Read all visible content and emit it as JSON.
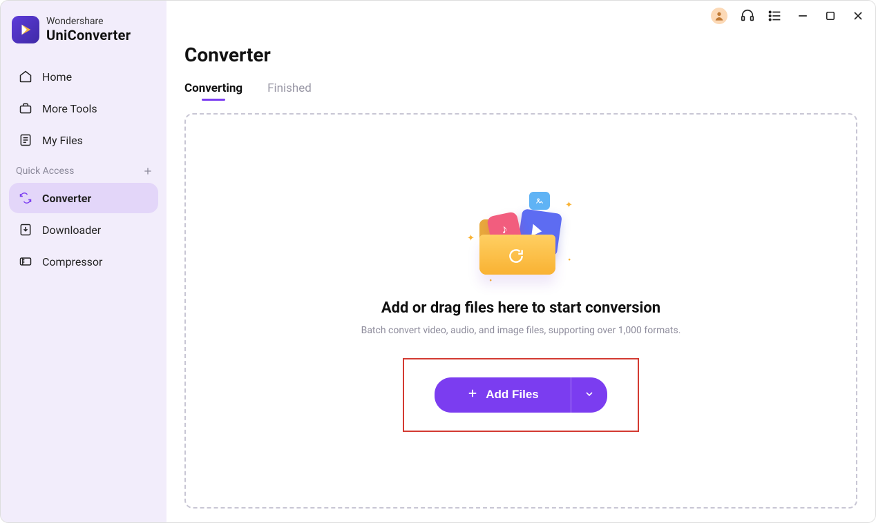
{
  "brand": {
    "top": "Wondershare",
    "bottom": "UniConverter"
  },
  "sidebar": {
    "items": [
      {
        "label": "Home"
      },
      {
        "label": "More Tools"
      },
      {
        "label": "My Files"
      }
    ],
    "quick_label": "Quick Access",
    "quick_items": [
      {
        "label": "Converter"
      },
      {
        "label": "Downloader"
      },
      {
        "label": "Compressor"
      }
    ]
  },
  "page": {
    "title": "Converter",
    "tabs": [
      {
        "label": "Converting"
      },
      {
        "label": "Finished"
      }
    ]
  },
  "dropzone": {
    "heading": "Add or drag files here to start conversion",
    "sub": "Batch convert video, audio, and image files, supporting over 1,000 formats.",
    "button": "Add Files"
  }
}
